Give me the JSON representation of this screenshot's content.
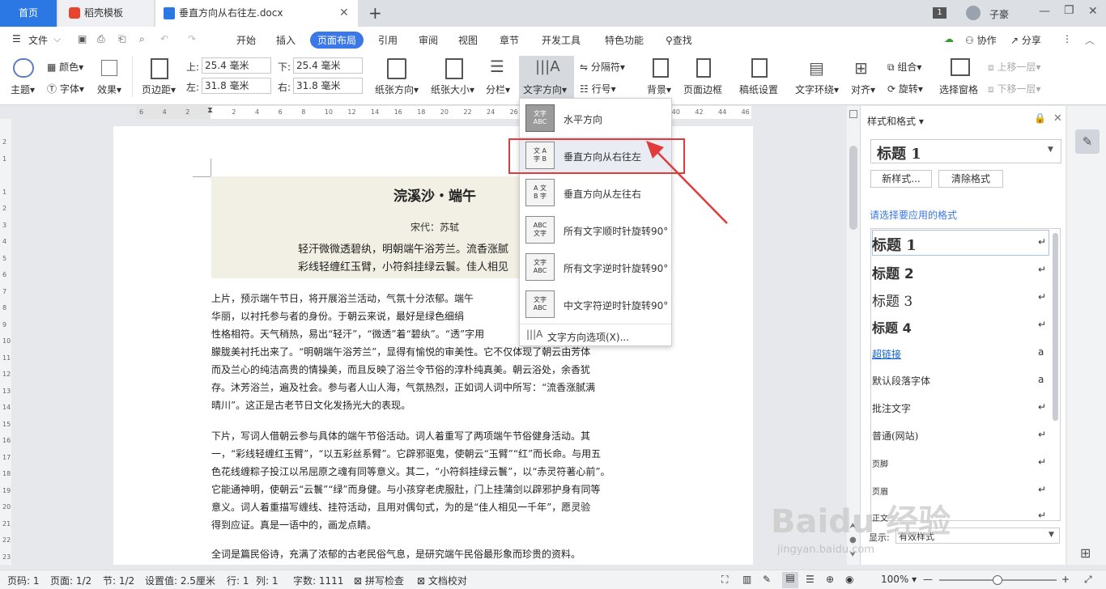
{
  "tabs": {
    "home": "首页",
    "template": "稻壳模板",
    "doc": "垂直方向从右往左.docx",
    "new": "+",
    "badge": "1",
    "user": "子豪"
  },
  "menu": {
    "file": "文件",
    "items": [
      "开始",
      "插入",
      "页面布局",
      "引用",
      "审阅",
      "视图",
      "章节",
      "开发工具",
      "特色功能"
    ],
    "search": "查找",
    "collab": "协作",
    "share": "分享"
  },
  "toolbar": {
    "theme": "主题",
    "colors": "颜色",
    "fonts": "字体",
    "effects": "效果",
    "margins": "页边距",
    "top_label": "上:",
    "top_val": "25.4 毫米",
    "bottom_label": "下:",
    "bottom_val": "25.4 毫米",
    "left_label": "左:",
    "left_val": "31.8 毫米",
    "right_label": "右:",
    "right_val": "31.8 毫米",
    "orientation": "纸张方向",
    "size": "纸张大小",
    "columns": "分栏",
    "text_dir": "文字方向",
    "breaks": "分隔符",
    "line_num": "行号",
    "background": "背景",
    "page_border": "页面边框",
    "grid_paper": "稿纸设置",
    "wrap": "文字环绕",
    "align": "对齐",
    "group": "组合",
    "rotate": "旋转",
    "selection": "选择窗格",
    "bring_fwd": "上移一层",
    "send_back": "下移一层"
  },
  "ruler": [
    "6",
    "4",
    "2",
    "",
    "2",
    "4",
    "6",
    "8",
    "10",
    "12",
    "14",
    "16",
    "18",
    "20",
    "22",
    "24",
    "26",
    "28",
    "30",
    "32",
    "34",
    "36",
    "38",
    "40",
    "42",
    "44",
    "46"
  ],
  "vruler": [
    "2",
    "1",
    "",
    "1",
    "2",
    "3",
    "4",
    "5",
    "6",
    "7",
    "8",
    "9",
    "10",
    "11",
    "12",
    "13",
    "14",
    "15",
    "16",
    "17",
    "18",
    "19",
    "20",
    "21",
    "22",
    "23"
  ],
  "doc": {
    "title": "浣溪沙・端午",
    "author": "宋代：苏轼",
    "poem": [
      "轻汗微微透碧纨，明朝端午浴芳兰。流香涨腻",
      "彩线轻缠红玉臂，小符斜挂绿云鬟。佳人相见"
    ],
    "p1": [
      "上片，预示端午节日，将开展浴兰活动，气氛十分浓郁。端午",
      "华丽，以衬托参与者的身份。于朝云来说，最好是绿色细绢",
      "性格相符。天气稍热，易出“轻汗”，“微透”着“碧纨”。“透”字用",
      "朦胧美衬托出来了。“明朝端午浴芳兰”，显得有愉悦的审美性。它不仅体现了朝云由芳体",
      "而及兰心的纯洁高贵的情操美，而且反映了浴兰令节俗的淳朴纯真美。朝云浴处，余香犹",
      "存。沐芳浴兰，遍及社会。参与者人山人海，气氛热烈，正如词人词中所写：“流香涨腻满",
      "晴川”。这正是古老节日文化发扬光大的表现。"
    ],
    "p2": [
      "下片，写词人借朝云参与具体的端午节俗活动。词人着重写了两项端午节俗健身活动。其",
      "一，“彩线轻缠红玉臂”，“以五彩丝系臂”。它辟邪驱鬼，使朝云“玉臂”“红”而长命。与用五",
      "色花线缠粽子投江以吊屈原之魂有同等意义。其二，“小符斜挂绿云鬟”，以“赤灵符著心前”。",
      "它能通神明，使朝云“云鬟”“绿”而身健。与小孩穿老虎服肚，门上挂蒲剑以辟邪护身有同等",
      "意义。词人着重描写缠线、挂符活动，且用对偶句式，为的是“佳人相见一千年”，愿灵验",
      "得到应证。真是一语中的，画龙点睛。"
    ],
    "p3": [
      "全词是篇民俗诗，充满了浓郁的古老民俗气息，是研究端午民俗最形象而珍贵的资料。"
    ]
  },
  "dropdown": {
    "items": [
      "水平方向",
      "垂直方向从右往左",
      "垂直方向从左往右",
      "所有文字顺时针旋转90°",
      "所有文字逆时针旋转90°",
      "中文字符逆时针旋转90°"
    ],
    "options": "文字方向选项(X)..."
  },
  "panel": {
    "title": "样式和格式",
    "current": "标题 1",
    "new_style": "新样式...",
    "clear": "清除格式",
    "apply_label": "请选择要应用的格式",
    "styles": [
      "标题 1",
      "标题 2",
      "标题 3",
      "标题 4",
      "超链接",
      "默认段落字体",
      "批注文字",
      "普通(网站)",
      "页脚",
      "页眉",
      "正文"
    ],
    "show_label": "显示:",
    "show_value": "有效样式"
  },
  "status": {
    "page": "页码: 1",
    "pages": "页面: 1/2",
    "section": "节: 1/2",
    "setting": "设置值: 2.5厘米",
    "row": "行: 1",
    "col": "列: 1",
    "words": "字数: 1111",
    "spell": "拼写检查",
    "proof": "文档校对",
    "zoom": "100%"
  },
  "watermark": {
    "line1": "Baidu 经验",
    "line2": "jingyan.baidu.com"
  },
  "colors": {
    "accent": "#3a78e7",
    "highlight": "#e03c3c",
    "link": "#0b5ed7"
  }
}
